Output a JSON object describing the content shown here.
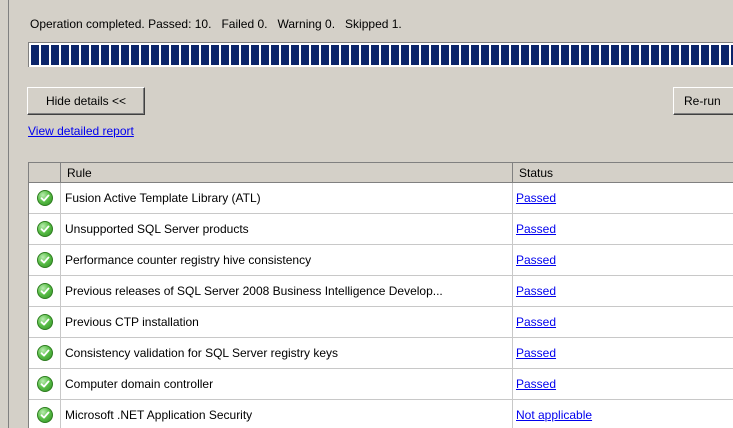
{
  "status": {
    "text": "Operation completed. Passed: 10.   Failed 0.   Warning 0.   Skipped 1."
  },
  "progress": {
    "fraction": 1.0
  },
  "buttons": {
    "hide_details": "Hide details <<",
    "rerun": "Re-run"
  },
  "links": {
    "view_report": "View detailed report"
  },
  "table": {
    "columns": [
      "Rule",
      "Status"
    ],
    "rows": [
      {
        "rule": "Fusion Active Template Library (ATL)",
        "status": "Passed",
        "icon": "check-icon"
      },
      {
        "rule": "Unsupported SQL Server products",
        "status": "Passed",
        "icon": "check-icon"
      },
      {
        "rule": "Performance counter registry hive consistency",
        "status": "Passed",
        "icon": "check-icon"
      },
      {
        "rule": "Previous releases of SQL Server 2008 Business Intelligence Develop...",
        "status": "Passed",
        "icon": "check-icon"
      },
      {
        "rule": "Previous CTP installation",
        "status": "Passed",
        "icon": "check-icon"
      },
      {
        "rule": "Consistency validation for SQL Server registry keys",
        "status": "Passed",
        "icon": "check-icon"
      },
      {
        "rule": "Computer domain controller",
        "status": "Passed",
        "icon": "check-icon"
      },
      {
        "rule": "Microsoft .NET Application Security",
        "status": "Not applicable",
        "icon": "check-icon"
      }
    ]
  },
  "colors": {
    "progress": "#0a246a",
    "link": "#0000ee",
    "check": "#5cc04a",
    "window": "#d4d0c8"
  }
}
